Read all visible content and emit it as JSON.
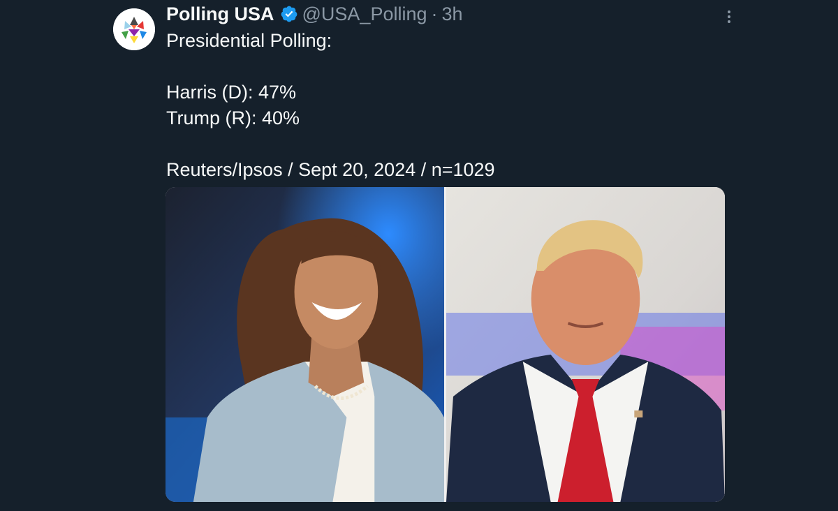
{
  "tweet": {
    "display_name": "Polling USA",
    "handle": "@USA_Polling",
    "separator": "·",
    "time": "3h",
    "lines": [
      "Presidential Polling:",
      "",
      "Harris (D): 47%",
      "Trump (R): 40%",
      "",
      "Reuters/Ipsos / Sept 20, 2024 / n=1029"
    ]
  },
  "icons": {
    "verified": "verified-badge-icon",
    "more": "more-options-icon"
  },
  "colors": {
    "background": "#15202b",
    "text": "#f7f9f9",
    "secondary_text": "#8b98a5",
    "verified": "#1d9bf0"
  }
}
